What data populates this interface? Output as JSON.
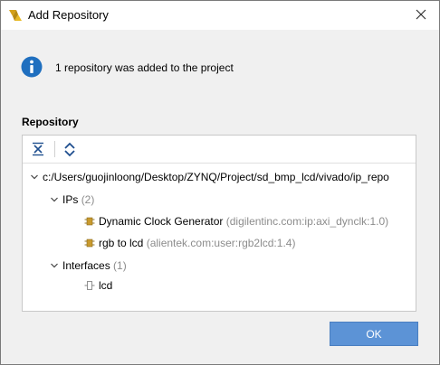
{
  "dialog": {
    "title": "Add Repository",
    "message": "1 repository was added to the project",
    "section_label": "Repository",
    "ok_label": "OK"
  },
  "tree": {
    "root_path": "c:/Users/guojinloong/Desktop/ZYNQ/Project/sd_bmp_lcd/vivado/ip_repo",
    "ips": {
      "label": "IPs",
      "count": "(2)",
      "items": [
        {
          "name": "Dynamic Clock Generator",
          "vlnv": "(digilentinc.com:ip:axi_dynclk:1.0)"
        },
        {
          "name": "rgb to lcd",
          "vlnv": "(alientek.com:user:rgb2lcd:1.4)"
        }
      ]
    },
    "interfaces": {
      "label": "Interfaces",
      "count": "(1)",
      "items": [
        {
          "name": "lcd"
        }
      ]
    }
  },
  "colors": {
    "ok_button": "#5c93d6",
    "info_icon": "#1f6fbf",
    "ip_icon": "#c99a2e"
  }
}
